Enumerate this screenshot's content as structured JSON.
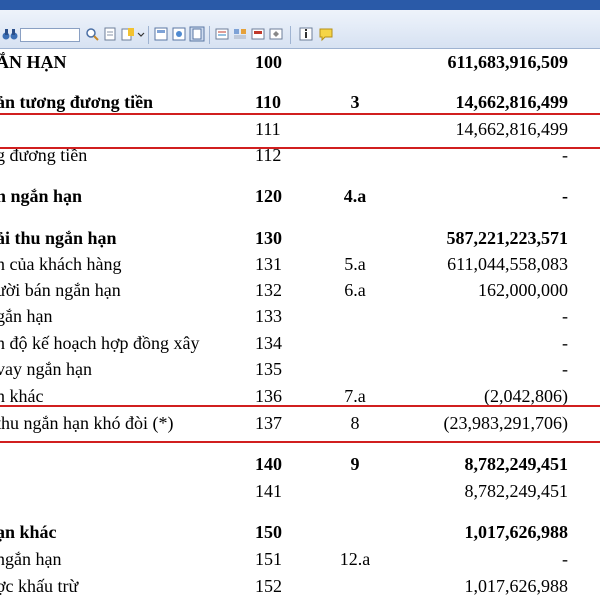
{
  "toolbar": {
    "icons": [
      "binoculars-icon",
      "search-input",
      "zoom-icon",
      "page-icon",
      "highlight-icon",
      "text-tool-icon",
      "view-icon",
      "layout-icon",
      "page-single-icon",
      "form-icon",
      "thumb-icon",
      "attach-icon",
      "stamp-icon",
      "info-icon",
      "comment-icon"
    ]
  },
  "rows": [
    {
      "name": "ẮN HẠN",
      "code": "100",
      "note": "",
      "value": "611,683,916,509",
      "bold": true
    },
    {
      "name": "ản tương đương tiền",
      "code": "110",
      "note": "3",
      "value": "14,662,816,499",
      "bold": true
    },
    {
      "name": "",
      "code": "111",
      "note": "",
      "value": "14,662,816,499",
      "bold": false
    },
    {
      "name": "g đương tiền",
      "code": "112",
      "note": "",
      "value": "-",
      "bold": false
    },
    {
      "name": "h ngắn hạn",
      "code": "120",
      "note": "4.a",
      "value": "-",
      "bold": true
    },
    {
      "name": "ải thu ngắn hạn",
      "code": "130",
      "note": "",
      "value": "587,221,223,571",
      "bold": true
    },
    {
      "name": "n của khách hàng",
      "code": "131",
      "note": "5.a",
      "value": "611,044,558,083",
      "bold": false
    },
    {
      "name": "ười bán ngắn hạn",
      "code": "132",
      "note": "6.a",
      "value": "162,000,000",
      "bold": false
    },
    {
      "name": "gắn hạn",
      "code": "133",
      "note": "",
      "value": "-",
      "bold": false
    },
    {
      "name": "n độ kế hoạch hợp đồng xây",
      "code": "134",
      "note": "",
      "value": "-",
      "bold": false
    },
    {
      "name": "vay ngắn hạn",
      "code": "135",
      "note": "",
      "value": "-",
      "bold": false
    },
    {
      "name": "n khác",
      "code": "136",
      "note": "7.a",
      "value": "(2,042,806)",
      "bold": false
    },
    {
      "name": "thu ngắn hạn khó đòi (*)",
      "code": "137",
      "note": "8",
      "value": "(23,983,291,706)",
      "bold": false
    },
    {
      "name": "",
      "code": "140",
      "note": "9",
      "value": "8,782,249,451",
      "bold": true
    },
    {
      "name": "",
      "code": "141",
      "note": "",
      "value": "8,782,249,451",
      "bold": false
    },
    {
      "name": "ạn khác",
      "code": "150",
      "note": "",
      "value": "1,017,626,988",
      "bold": true
    },
    {
      "name": "ngắn hạn",
      "code": "151",
      "note": "12.a",
      "value": "-",
      "bold": false
    },
    {
      "name": "ợc khấu trừ",
      "code": "152",
      "note": "",
      "value": "1,017,626,988",
      "bold": false
    }
  ],
  "colors": {
    "highlight_box": "#d11f1f",
    "toolbar_bg": "#d7e2f2"
  }
}
